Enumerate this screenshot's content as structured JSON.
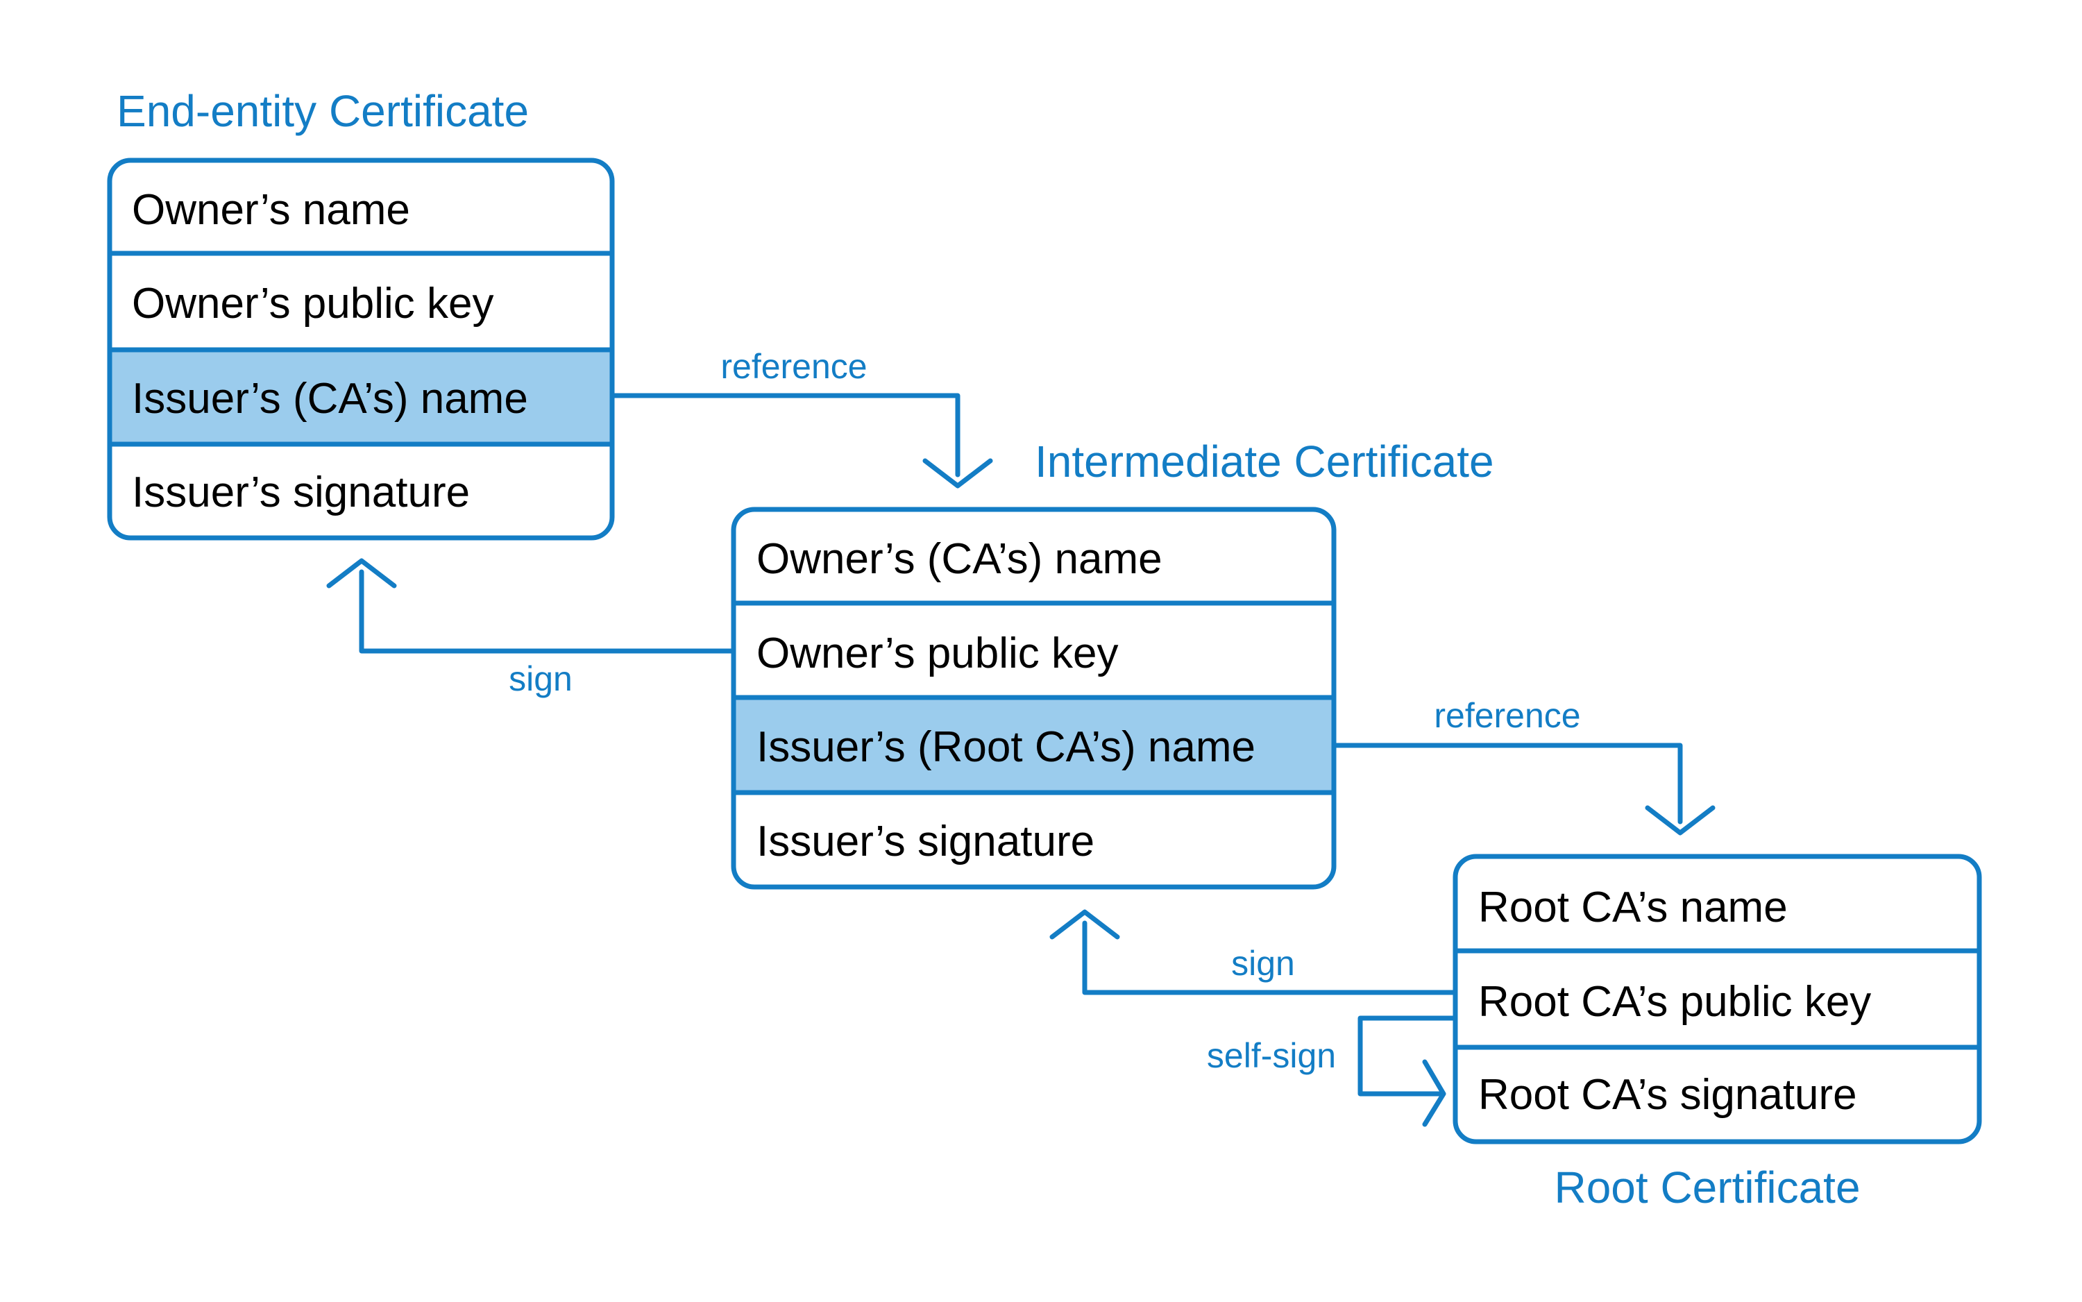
{
  "colors": {
    "accent": "#137dc5",
    "highlight_fill": "#9bcced",
    "text": "#000000",
    "background": "#ffffff"
  },
  "certificates": {
    "end_entity": {
      "title": "End-entity Certificate",
      "fields": [
        "Owner’s name",
        "Owner’s public key",
        "Issuer’s (CA’s) name",
        "Issuer’s signature"
      ],
      "highlighted_field": 2
    },
    "intermediate": {
      "title": "Intermediate Certificate",
      "fields": [
        "Owner’s (CA’s) name",
        "Owner’s public key",
        "Issuer’s (Root CA’s) name",
        "Issuer’s signature"
      ],
      "highlighted_field": 2
    },
    "root": {
      "title": "Root Certificate",
      "fields": [
        "Root CA’s name",
        "Root CA’s public key",
        "Root CA’s signature"
      ],
      "highlighted_field": null
    }
  },
  "connectors": {
    "ref1": {
      "label": "reference",
      "from": "end_entity.Issuer’s (CA’s) name",
      "to": "intermediate"
    },
    "sign1": {
      "label": "sign",
      "from": "intermediate.Owner’s public key",
      "to": "end_entity"
    },
    "ref2": {
      "label": "reference",
      "from": "intermediate.Issuer’s (Root CA’s) name",
      "to": "root"
    },
    "sign2": {
      "label": "sign",
      "from": "root.Root CA’s public key",
      "to": "intermediate"
    },
    "selfsign": {
      "label": "self-sign",
      "from": "root.Root CA’s public key",
      "to": "root.Root CA’s signature"
    }
  }
}
